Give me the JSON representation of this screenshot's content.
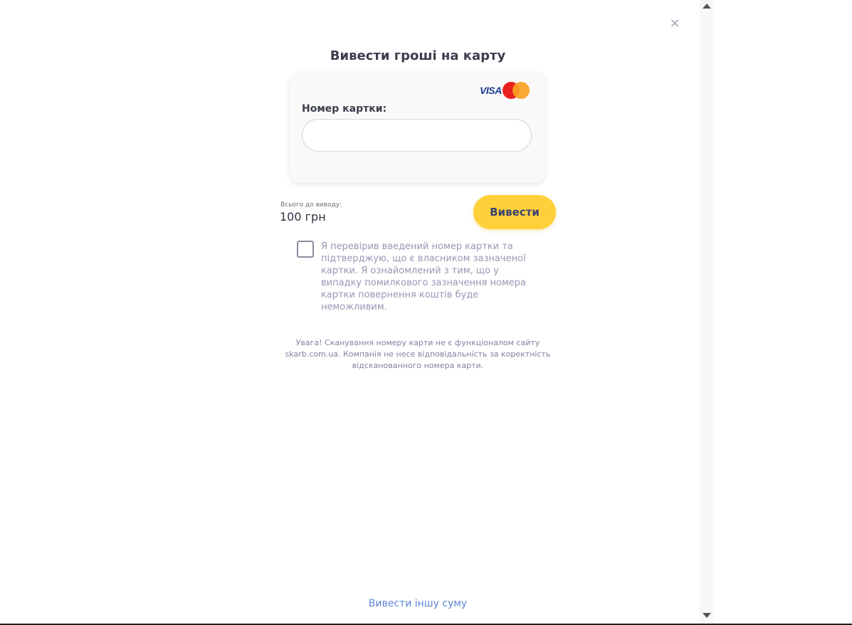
{
  "modal": {
    "close_icon": "×",
    "title": "Вивести гроші на карту"
  },
  "card_form": {
    "logos": [
      "visa-logo",
      "mastercard-logo"
    ],
    "visa_text": "VISA",
    "card_number_label": "Номер картки:",
    "card_number_value": "",
    "card_number_placeholder": ""
  },
  "summary": {
    "total_caption": "Всього до виводу:",
    "total_amount": "100 грн",
    "withdraw_button": "Вивести"
  },
  "confirmation": {
    "checked": false,
    "text": "Я перевірив введений номер картки та підтверджую, що є власником зазначеної картки. Я ознайомлений з тим, що у випадку помилкового зазначення номера картки повернення коштів буде неможливим."
  },
  "notice": "Увага! Сканування номеру карти не є функціоналом сайту skarb.com.ua. Компанія не несе відповідальність за коректність відсканованного номера карти.",
  "footer": {
    "other_sum_link": "Вивести іншу суму"
  },
  "colors": {
    "accent_button": "#ffd03a",
    "link": "#5e86d6",
    "title": "#3b3e4c"
  }
}
